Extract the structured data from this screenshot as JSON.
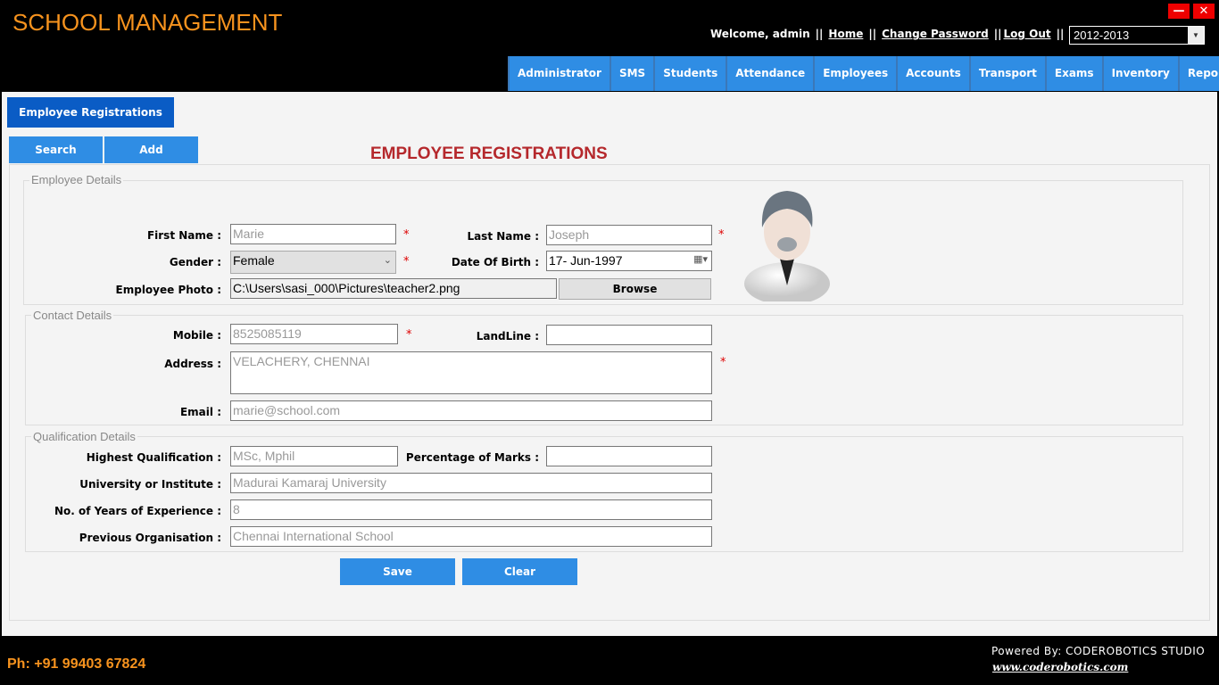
{
  "app": {
    "title": "SCHOOL MANAGEMENT",
    "minimize": "—",
    "close": "✕"
  },
  "header": {
    "welcome": "Welcome, admin",
    "sep": "||",
    "home": "Home",
    "change_password": "Change Password",
    "logout": "Log Out",
    "year": "2012-2013"
  },
  "nav": [
    "Administrator",
    "SMS",
    "Students",
    "Attendance",
    "Employees",
    "Accounts",
    "Transport",
    "Exams",
    "Inventory",
    "Reports"
  ],
  "tab": "Employee Registrations",
  "actions": {
    "search": "Search",
    "add": "Add"
  },
  "heading": "EMPLOYEE REGISTRATIONS",
  "employee": {
    "legend": "Employee Details",
    "first_name_label": "First Name :",
    "first_name": "Marie",
    "last_name_label": "Last Name :",
    "last_name": "Joseph",
    "gender_label": "Gender :",
    "gender": "Female",
    "dob_label": "Date Of Birth :",
    "dob": "17- Jun-1997",
    "photo_label": "Employee Photo :",
    "photo": "C:\\Users\\sasi_000\\Pictures\\teacher2.png",
    "browse": "Browse"
  },
  "contact": {
    "legend": "Contact Details",
    "mobile_label": "Mobile :",
    "mobile": "8525085119",
    "landline_label": "LandLine :",
    "landline": "",
    "address_label": "Address :",
    "address": "VELACHERY, CHENNAI",
    "email_label": "Email :",
    "email": "marie@school.com"
  },
  "qualification": {
    "legend": "Qualification Details",
    "highest_label": "Highest Qualification :",
    "highest": "MSc, Mphil",
    "percent_label": "Percentage of Marks :",
    "percent": "",
    "university_label": "University or Institute :",
    "university": "Madurai Kamaraj University",
    "experience_label": "No. of Years of Experience :",
    "experience": "8",
    "prev_org_label": "Previous Organisation :",
    "prev_org": "Chennai International School"
  },
  "buttons": {
    "save": "Save",
    "clear": "Clear"
  },
  "required": "*",
  "footer": {
    "phone": "Ph: +91 99403 67824",
    "powered": "Powered By: CODEROBOTICS STUDIO",
    "site": "www.coderobotics.com"
  }
}
